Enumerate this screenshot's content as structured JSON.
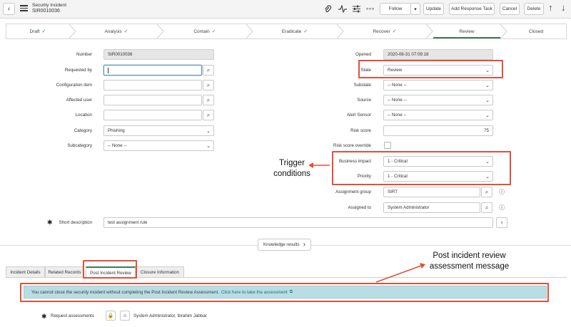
{
  "header": {
    "title_line1": "Security Incident",
    "title_line2": "SIR0010036",
    "buttons": {
      "follow": "Follow",
      "update": "Update",
      "add_response_task": "Add Response Task",
      "cancel": "Cancel",
      "delete": "Delete"
    },
    "icons": {
      "back": "‹",
      "attach": "📎",
      "activity": "⌇",
      "settings": "≡",
      "more": "∘∘∘",
      "follow_dropdown": "▾",
      "up": "↑",
      "down": "↓"
    }
  },
  "stages": [
    {
      "label": "Draft",
      "done": true
    },
    {
      "label": "Analysis",
      "done": true
    },
    {
      "label": "Contain",
      "done": true
    },
    {
      "label": "Eradicate",
      "done": true
    },
    {
      "label": "Recover",
      "done": true
    },
    {
      "label": "Review",
      "done": false
    },
    {
      "label": "Closed",
      "done": false
    }
  ],
  "check": "✓",
  "left_fields": {
    "number": {
      "label": "Number",
      "value": "SIR0010036"
    },
    "requested_by": {
      "label": "Requested by",
      "value": ""
    },
    "configuration_item": {
      "label": "Configuration item",
      "value": ""
    },
    "affected_user": {
      "label": "Affected user",
      "value": ""
    },
    "location": {
      "label": "Location",
      "value": ""
    },
    "category": {
      "label": "Category",
      "value": "Phishing"
    },
    "subcategory": {
      "label": "Subcategory",
      "value": "-- None --"
    }
  },
  "right_fields": {
    "opened": {
      "label": "Opened",
      "value": "2020-08-31 07:09:18"
    },
    "state": {
      "label": "State",
      "value": "Review"
    },
    "substate": {
      "label": "Substate",
      "value": "-- None --"
    },
    "source": {
      "label": "Source",
      "value": "-- None --"
    },
    "alert_sensor": {
      "label": "Alert Sensor",
      "value": "-- None --"
    },
    "risk_score": {
      "label": "Risk score",
      "value": "75"
    },
    "risk_score_override": {
      "label": "Risk score override"
    },
    "business_impact": {
      "label": "Business impact",
      "value": "1 - Critical"
    },
    "priority": {
      "label": "Priority",
      "value": "1 - Critical"
    },
    "assignment_group": {
      "label": "Assignment group",
      "value": "SIRT"
    },
    "assigned_to": {
      "label": "Assigned to",
      "value": "System Administrator"
    }
  },
  "short_description": {
    "label": "Short description",
    "value": "test assignment rule"
  },
  "knowledge_results": "Knowledge results",
  "tabs": [
    {
      "label": "Incident Details"
    },
    {
      "label": "Related Records"
    },
    {
      "label": "Post Incident Review"
    },
    {
      "label": "Closure Information"
    }
  ],
  "message": {
    "text": "You cannot close the security incident without completing the Post Incident Review Assessment.",
    "link": "Click here to take the assessment"
  },
  "request_assessments": {
    "label": "Request assessments",
    "value": "System Administrator, Ibrahim Jabbar"
  },
  "annotations": {
    "trigger_line1": "Trigger",
    "trigger_line2": "conditions",
    "pir_line1": "Post incident review",
    "pir_line2": "assessment message"
  },
  "glyphs": {
    "search": "⌕",
    "info": "ⓘ",
    "chevron": "⌄",
    "star": "✱",
    "lock": "🔒",
    "person": "☺",
    "bulb": "♀",
    "next": "›",
    "external": "⧉"
  },
  "colors": {
    "accent_green": "#3d7a5a",
    "annotation_red": "#e2503a",
    "message_bg": "#b9dde2"
  }
}
